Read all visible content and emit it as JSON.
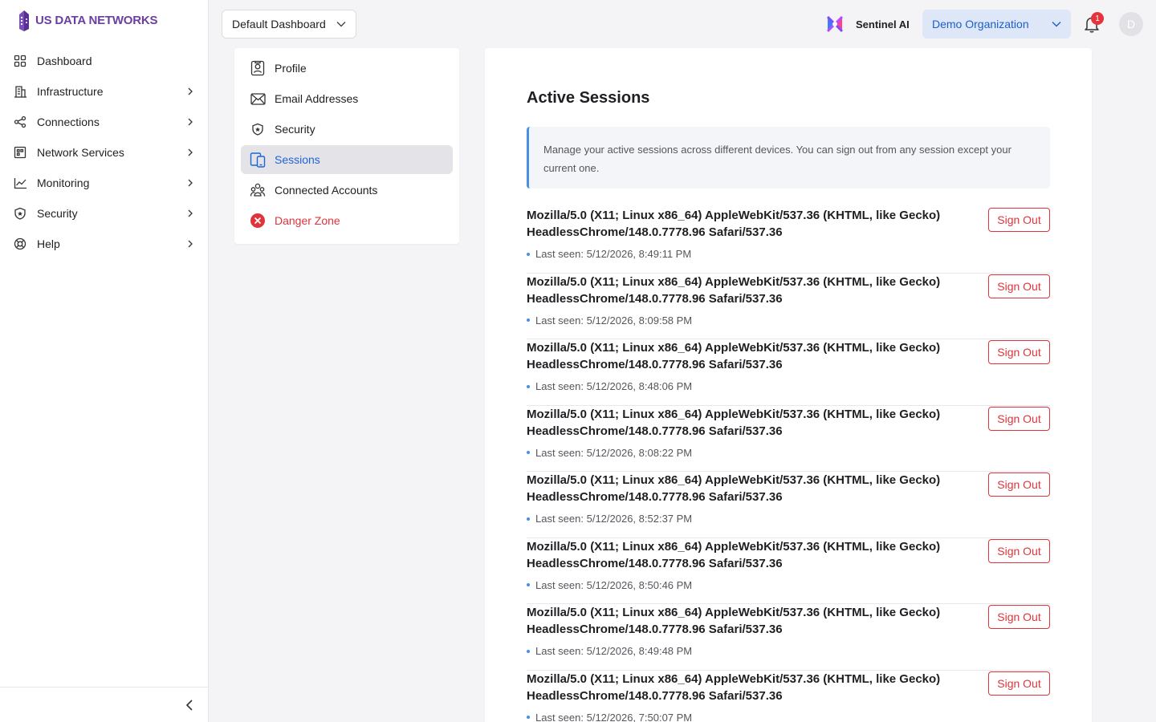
{
  "brand": {
    "name": "US DATA NETWORKS",
    "logo_icon": "building-logo-icon",
    "color": "#6b3fa0"
  },
  "sidebar": {
    "items": [
      {
        "label": "Dashboard",
        "icon": "grid-icon",
        "has_children": false
      },
      {
        "label": "Infrastructure",
        "icon": "building-icon",
        "has_children": true
      },
      {
        "label": "Connections",
        "icon": "share-nodes-icon",
        "has_children": true
      },
      {
        "label": "Network Services",
        "icon": "network-icon",
        "has_children": true
      },
      {
        "label": "Monitoring",
        "icon": "line-chart-icon",
        "has_children": true
      },
      {
        "label": "Security",
        "icon": "shield-icon",
        "has_children": true
      },
      {
        "label": "Help",
        "icon": "lifebuoy-icon",
        "has_children": true
      }
    ],
    "collapse_icon": "chevron-left-icon"
  },
  "topbar": {
    "dashboard_select": "Default Dashboard",
    "sentinel_label": "Sentinel AI",
    "organization_select": "Demo Organization",
    "notification_count": "1",
    "avatar_initial": "D"
  },
  "settings_menu": {
    "items": [
      {
        "label": "Profile",
        "icon": "profile-icon",
        "state": "normal"
      },
      {
        "label": "Email Addresses",
        "icon": "envelope-icon",
        "state": "normal"
      },
      {
        "label": "Security",
        "icon": "shield-icon",
        "state": "normal"
      },
      {
        "label": "Sessions",
        "icon": "devices-icon",
        "state": "active"
      },
      {
        "label": "Connected Accounts",
        "icon": "users-icon",
        "state": "normal"
      },
      {
        "label": "Danger Zone",
        "icon": "error-circle-icon",
        "state": "danger"
      }
    ]
  },
  "sessions": {
    "title": "Active Sessions",
    "info": "Manage your active sessions across different devices. You can sign out from any session except your current one.",
    "sign_out_label": "Sign Out",
    "items": [
      {
        "user_agent": "Mozilla/5.0 (X11; Linux x86_64) AppleWebKit/537.36 (KHTML, like Gecko) HeadlessChrome/148.0.7778.96 Safari/537.36",
        "last_seen": "Last seen: 5/12/2026, 8:49:11 PM"
      },
      {
        "user_agent": "Mozilla/5.0 (X11; Linux x86_64) AppleWebKit/537.36 (KHTML, like Gecko) HeadlessChrome/148.0.7778.96 Safari/537.36",
        "last_seen": "Last seen: 5/12/2026, 8:09:58 PM"
      },
      {
        "user_agent": "Mozilla/5.0 (X11; Linux x86_64) AppleWebKit/537.36 (KHTML, like Gecko) HeadlessChrome/148.0.7778.96 Safari/537.36",
        "last_seen": "Last seen: 5/12/2026, 8:48:06 PM"
      },
      {
        "user_agent": "Mozilla/5.0 (X11; Linux x86_64) AppleWebKit/537.36 (KHTML, like Gecko) HeadlessChrome/148.0.7778.96 Safari/537.36",
        "last_seen": "Last seen: 5/12/2026, 8:08:22 PM"
      },
      {
        "user_agent": "Mozilla/5.0 (X11; Linux x86_64) AppleWebKit/537.36 (KHTML, like Gecko) HeadlessChrome/148.0.7778.96 Safari/537.36",
        "last_seen": "Last seen: 5/12/2026, 8:52:37 PM"
      },
      {
        "user_agent": "Mozilla/5.0 (X11; Linux x86_64) AppleWebKit/537.36 (KHTML, like Gecko) HeadlessChrome/148.0.7778.96 Safari/537.36",
        "last_seen": "Last seen: 5/12/2026, 8:50:46 PM"
      },
      {
        "user_agent": "Mozilla/5.0 (X11; Linux x86_64) AppleWebKit/537.36 (KHTML, like Gecko) HeadlessChrome/148.0.7778.96 Safari/537.36",
        "last_seen": "Last seen: 5/12/2026, 8:49:48 PM"
      },
      {
        "user_agent": "Mozilla/5.0 (X11; Linux x86_64) AppleWebKit/537.36 (KHTML, like Gecko) HeadlessChrome/148.0.7778.96 Safari/537.36",
        "last_seen": "Last seen: 5/12/2026, 7:50:07 PM"
      }
    ]
  },
  "colors": {
    "accent": "#1d64d6",
    "danger": "#e0333b",
    "info_border": "#4a90e2"
  }
}
